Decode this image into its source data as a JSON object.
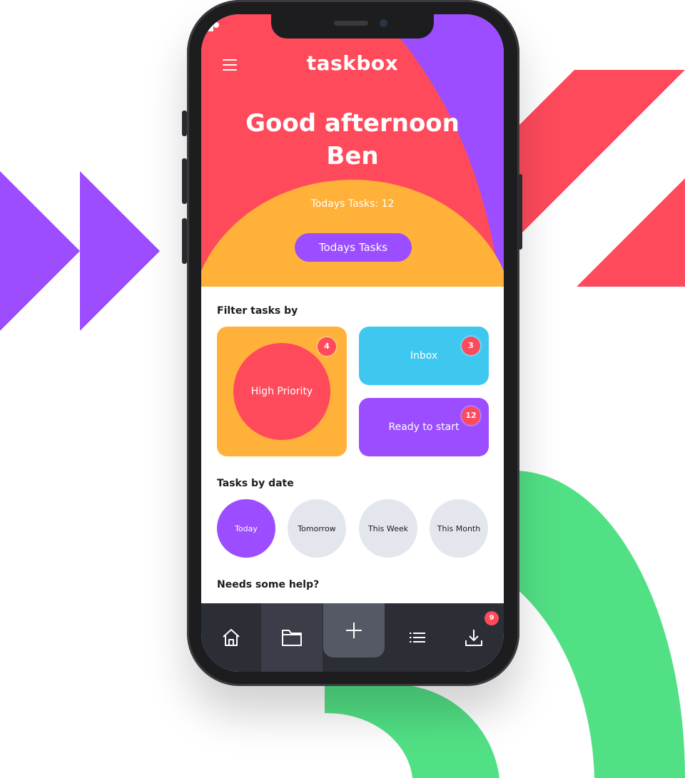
{
  "app": {
    "title": "taskbox"
  },
  "header": {
    "greeting_line1": "Good afternoon",
    "greeting_line2": "Ben",
    "tasks_count": "Todays Tasks: 12",
    "button_label": "Todays Tasks"
  },
  "filter": {
    "heading": "Filter tasks by",
    "tiles": [
      {
        "label": "High Priority",
        "count": "4"
      },
      {
        "label": "Inbox",
        "count": "3"
      },
      {
        "label": "Ready to start",
        "count": "12"
      }
    ]
  },
  "by_date": {
    "heading": "Tasks by date",
    "options": [
      "Today",
      "Tomorrow",
      "This Week",
      "This Month"
    ],
    "selected": "Today"
  },
  "help": {
    "heading": "Needs some help?"
  },
  "tabbar": {
    "items": [
      {
        "icon": "home-icon"
      },
      {
        "icon": "folder-icon"
      },
      {
        "icon": "plus-icon"
      },
      {
        "icon": "list-icon"
      },
      {
        "icon": "download-icon",
        "badge": "9"
      }
    ]
  },
  "colors": {
    "red": "#ff4a5c",
    "purple": "#9b4dff",
    "orange": "#ffb13a",
    "cyan": "#3ec8ef",
    "green": "#52e085",
    "dark": "#2c2e36"
  }
}
